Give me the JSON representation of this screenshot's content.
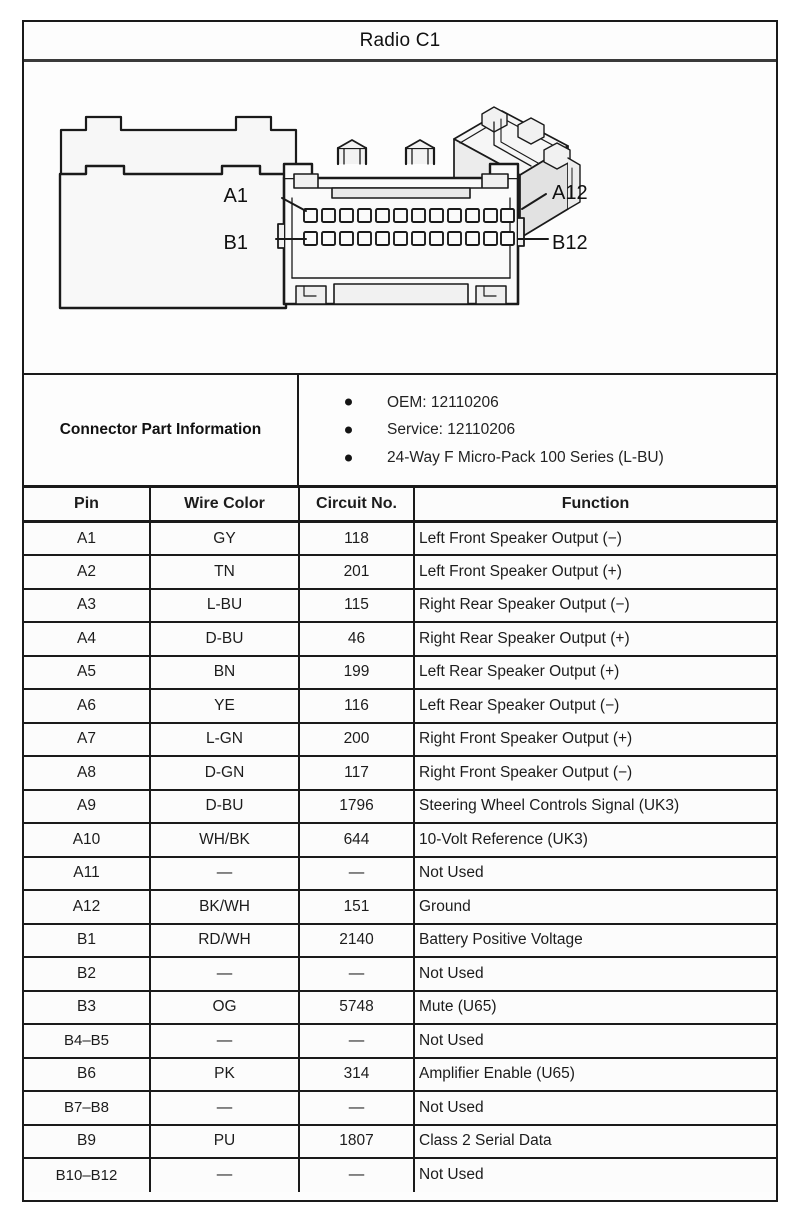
{
  "header": {
    "title": "Radio C1"
  },
  "connector_illustration": {
    "front_view": {
      "row_a_pin_count": 12,
      "row_b_pin_count": 12,
      "labels": {
        "top_left": "A1",
        "bottom_left": "B1",
        "top_right": "A12",
        "bottom_right": "B12"
      }
    },
    "iso_view_name": "connector-isometric-view"
  },
  "connector_part_information": {
    "label": "Connector Part Information",
    "items": [
      "OEM: 12110206",
      "Service: 12110206",
      "24-Way F Micro-Pack 100 Series (L-BU)"
    ]
  },
  "pinout_table": {
    "columns": [
      "Pin",
      "Wire Color",
      "Circuit No.",
      "Function"
    ],
    "rows": [
      {
        "pin": "A1",
        "wire": "GY",
        "circuit": "118",
        "function": "Left Front Speaker Output (−)"
      },
      {
        "pin": "A2",
        "wire": "TN",
        "circuit": "201",
        "function": "Left Front Speaker Output (+)"
      },
      {
        "pin": "A3",
        "wire": "L-BU",
        "circuit": "115",
        "function": "Right Rear Speaker Output (−)"
      },
      {
        "pin": "A4",
        "wire": "D-BU",
        "circuit": "46",
        "function": "Right Rear Speaker Output (+)"
      },
      {
        "pin": "A5",
        "wire": "BN",
        "circuit": "199",
        "function": "Left Rear Speaker Output (+)"
      },
      {
        "pin": "A6",
        "wire": "YE",
        "circuit": "116",
        "function": "Left Rear Speaker Output (−)"
      },
      {
        "pin": "A7",
        "wire": "L-GN",
        "circuit": "200",
        "function": "Right Front Speaker Output (+)"
      },
      {
        "pin": "A8",
        "wire": "D-GN",
        "circuit": "117",
        "function": "Right Front Speaker Output (−)"
      },
      {
        "pin": "A9",
        "wire": "D-BU",
        "circuit": "1796",
        "function": "Steering Wheel Controls Signal (UK3)"
      },
      {
        "pin": "A10",
        "wire": "WH/BK",
        "circuit": "644",
        "function": "10-Volt Reference (UK3)"
      },
      {
        "pin": "A11",
        "wire": "—",
        "circuit": "—",
        "function": "Not Used"
      },
      {
        "pin": "A12",
        "wire": "BK/WH",
        "circuit": "151",
        "function": "Ground"
      },
      {
        "pin": "B1",
        "wire": "RD/WH",
        "circuit": "2140",
        "function": "Battery Positive Voltage"
      },
      {
        "pin": "B2",
        "wire": "—",
        "circuit": "—",
        "function": "Not Used"
      },
      {
        "pin": "B3",
        "wire": "OG",
        "circuit": "5748",
        "function": "Mute (U65)"
      },
      {
        "pin": "B4–B5",
        "wire": "—",
        "circuit": "—",
        "function": "Not Used"
      },
      {
        "pin": "B6",
        "wire": "PK",
        "circuit": "314",
        "function": "Amplifier Enable (U65)"
      },
      {
        "pin": "B7–B8",
        "wire": "—",
        "circuit": "—",
        "function": "Not Used"
      },
      {
        "pin": "B9",
        "wire": "PU",
        "circuit": "1807",
        "function": "Class 2 Serial Data"
      },
      {
        "pin": "B10–B12",
        "wire": "—",
        "circuit": "—",
        "function": "Not Used"
      }
    ]
  },
  "colors": {
    "border": "#1a1a1a",
    "page_background": "#ffffff",
    "cell_background": "#fcfcfc",
    "text": "#1c1c1c",
    "illustration_line": "#1a1a1a",
    "illustration_fill": "#f2f2f2"
  }
}
